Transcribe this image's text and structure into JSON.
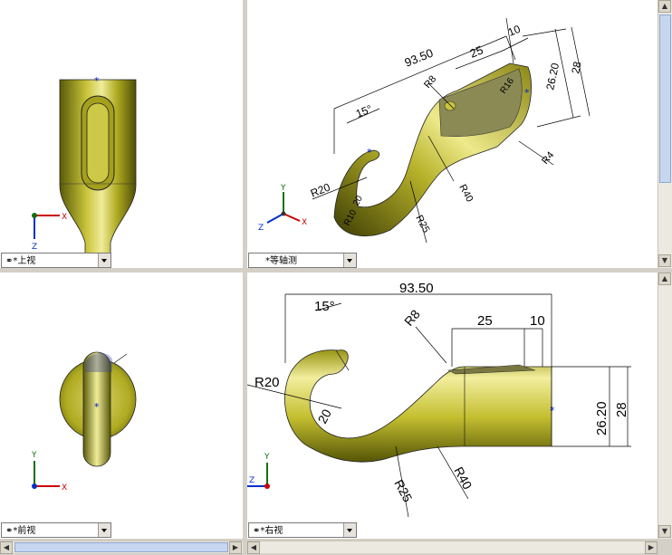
{
  "viewports": {
    "top": {
      "label": "*上视"
    },
    "iso": {
      "label": "*等轴测"
    },
    "front": {
      "label": "*前视"
    },
    "right": {
      "label": "*右视"
    }
  },
  "axes": {
    "x": "X",
    "y": "Y",
    "z": "Z"
  },
  "dims": {
    "d9350": "93.50",
    "d25": "25",
    "d10": "10",
    "d2620": "26.20",
    "d28": "28",
    "a15": "15°",
    "r8": "R8",
    "r20": "R20",
    "r25": "R25",
    "r40": "R40",
    "r4": "R4",
    "r16": "R16",
    "r20b": "R20",
    "n20": "20",
    "r10": "R10"
  },
  "colors": {
    "model_base": "#b5b025",
    "model_dark": "#4a4a05",
    "model_light": "#f4f0b0",
    "background": "#ffffff",
    "divider": "#d4d0c8"
  }
}
